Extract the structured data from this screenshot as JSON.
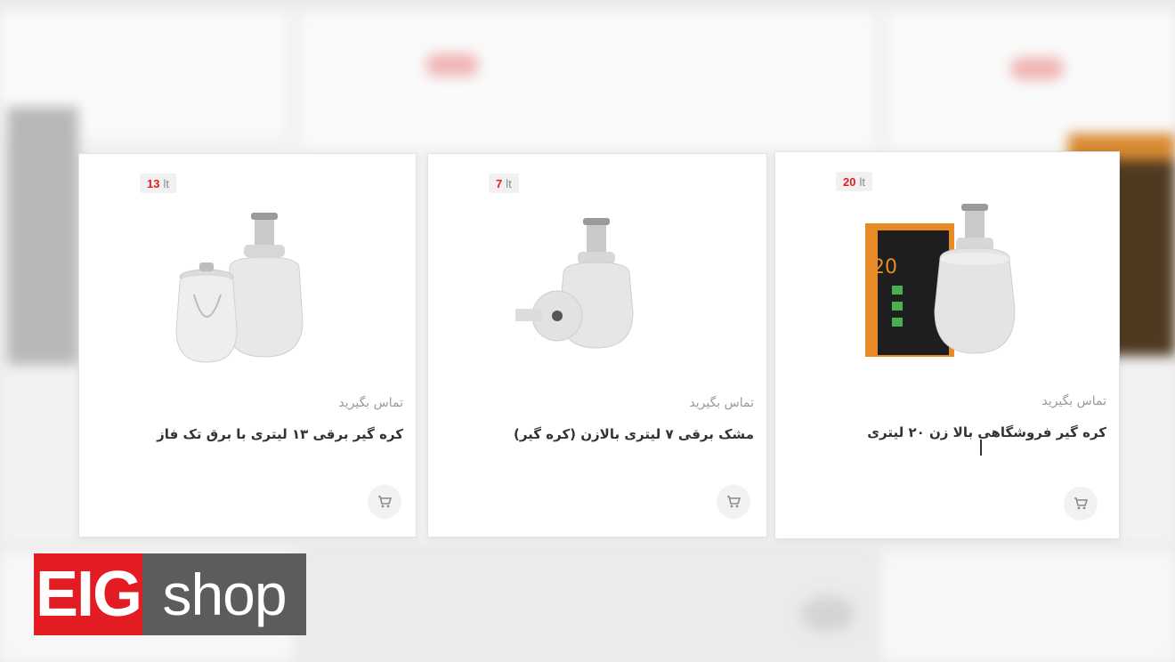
{
  "products": [
    {
      "capacity": "20",
      "unit": "lt",
      "contact_label": "تماس بگیرید",
      "title": "کره گیر فروشگاهی بالا زن ۲۰ لیتری",
      "image": "butter-churn-with-box-icon"
    },
    {
      "capacity": "7",
      "unit": "lt",
      "contact_label": "تماس بگیرید",
      "title": "مشک برقی ۷ لیتری بالازن (کره گیر)",
      "image": "butter-churn-with-motor-icon"
    },
    {
      "capacity": "13",
      "unit": "lt",
      "contact_label": "تماس بگیرید",
      "title": "کره گیر برقی ۱۳ لیتری با برق تک فاز",
      "image": "butter-churn-with-pot-icon"
    }
  ],
  "logo": {
    "part1": "EIG",
    "part2": "shop"
  },
  "colors": {
    "accent": "#e31b23",
    "logo_grey": "#5c5c5c",
    "badge_number": "#e02020"
  },
  "icons": {
    "cart": "shopping-cart-icon"
  }
}
